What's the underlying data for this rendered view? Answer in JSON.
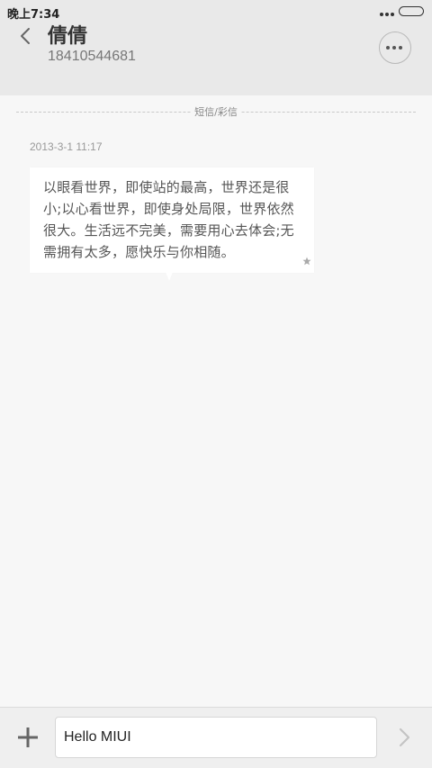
{
  "status_bar": {
    "time": "晚上7:34"
  },
  "header": {
    "contact_name": "倩倩",
    "contact_number": "18410544681"
  },
  "thread": {
    "divider_label": "短信/彩信",
    "messages": [
      {
        "time": "2013-3-1 11:17",
        "text": "以眼看世界，即使站的最高，世界还是很小;以心看世界，即使身处局限，世界依然很大。生活远不完美，需要用心去体会;无需拥有太多，愿快乐与你相随。",
        "starred": true
      }
    ]
  },
  "composer": {
    "input_value": "Hello MIUI"
  },
  "icons": {
    "back": "chevron-left-icon",
    "more": "more-dots-icon",
    "star": "star-icon",
    "add": "plus-icon",
    "send": "chevron-right-icon"
  },
  "colors": {
    "header_bg": "#e9e9e9",
    "page_bg": "#f7f7f7",
    "bubble_bg": "#ffffff"
  }
}
